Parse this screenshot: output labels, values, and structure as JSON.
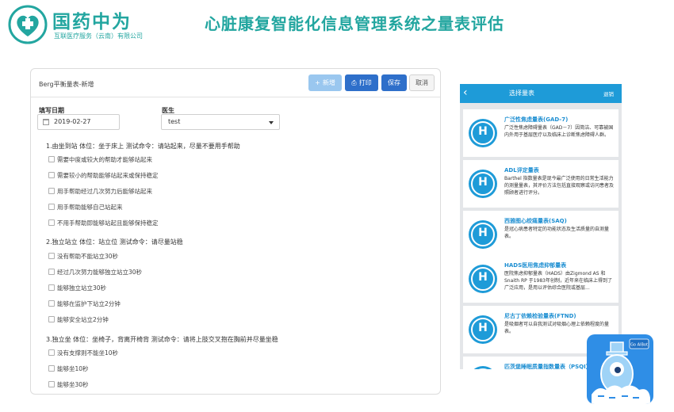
{
  "brand": {
    "name": "国药中为",
    "subtitle": "互联医疗服务（云南）有限公司"
  },
  "page_title": "心脏康复智能化信息管理系统之量表评估",
  "form": {
    "title": "Berg平衡量表-新增",
    "buttons": {
      "add": "新增",
      "print": "打印",
      "save": "保存",
      "cancel": "取消"
    },
    "date_label": "填写日期",
    "date_value": "2019-02-27",
    "doctor_label": "医生",
    "doctor_value": "test",
    "questions": [
      {
        "text": "1.由坐到站 体位：坐于床上 测试命令：请站起来，尽量不要用手帮助",
        "options": [
          "需要中度或较大的帮助才能够站起来",
          "需要较小的帮助能够站起来或保持稳定",
          "用手帮助经过几次努力后能够站起来",
          "用手帮助能够自己站起来",
          "不用手帮助即能够站起且能够保持稳定"
        ]
      },
      {
        "text": "2.独立站立 体位：站立位 测试命令：请尽量站稳",
        "options": [
          "没有帮助不能站立30秒",
          "经过几次努力能够独立站立30秒",
          "能够独立站立30秒",
          "能够在监护下站立2分钟",
          "能够安全站立2分钟"
        ]
      },
      {
        "text": "3.独立坐 体位：坐椅子，背离开椅背 测试命令：请将上肢交叉抱在胸前并尽量坐稳",
        "options": [
          "没有支撑则不能坐10秒",
          "能够坐10秒",
          "能够坐30秒"
        ]
      }
    ]
  },
  "phone": {
    "title": "选择量表",
    "logout": "退销",
    "items": [
      {
        "name": "广泛性焦虑量表(GAD-7)",
        "desc": "广泛性焦虑障碍量表（GAD－7）因简洁、可靠被国内外用于基层医疗以及临床上诊断焦虑障碍人群。"
      },
      {
        "name": "ADL评定量表",
        "desc": "Barthel 指数量表是现今最广泛使用的日常生活能力的测量量表，其评价方法包括直接观察或访问患者及照顾者进行评分。"
      },
      {
        "name": "西雅图心绞痛量表(SAQ)",
        "desc": "是冠心病患者特定的功能状态及生活质量的自测量表。"
      },
      {
        "name": "HADS医用焦虑抑郁量表",
        "desc": "医院焦虑抑郁量表（HADS）由Zigmond AS 和 Snaith RP 于1983年创制，近年来在临床上得到了广泛应用，是用以评估综合医院或基层..."
      },
      {
        "name": "尼古丁依赖检验量表(FTND)",
        "desc": "是吸烟者可以自我测试对吸烟心理上依赖程度的量表。"
      },
      {
        "name": "匹茨堡睡眠质量指数量表（PSQI）",
        "desc": ""
      }
    ]
  },
  "mascot": {
    "badge": "Go AIBot"
  },
  "colors": {
    "brand": "#23a6a0",
    "primary": "#2e6fca",
    "phone_accent": "#1e9bd8"
  }
}
